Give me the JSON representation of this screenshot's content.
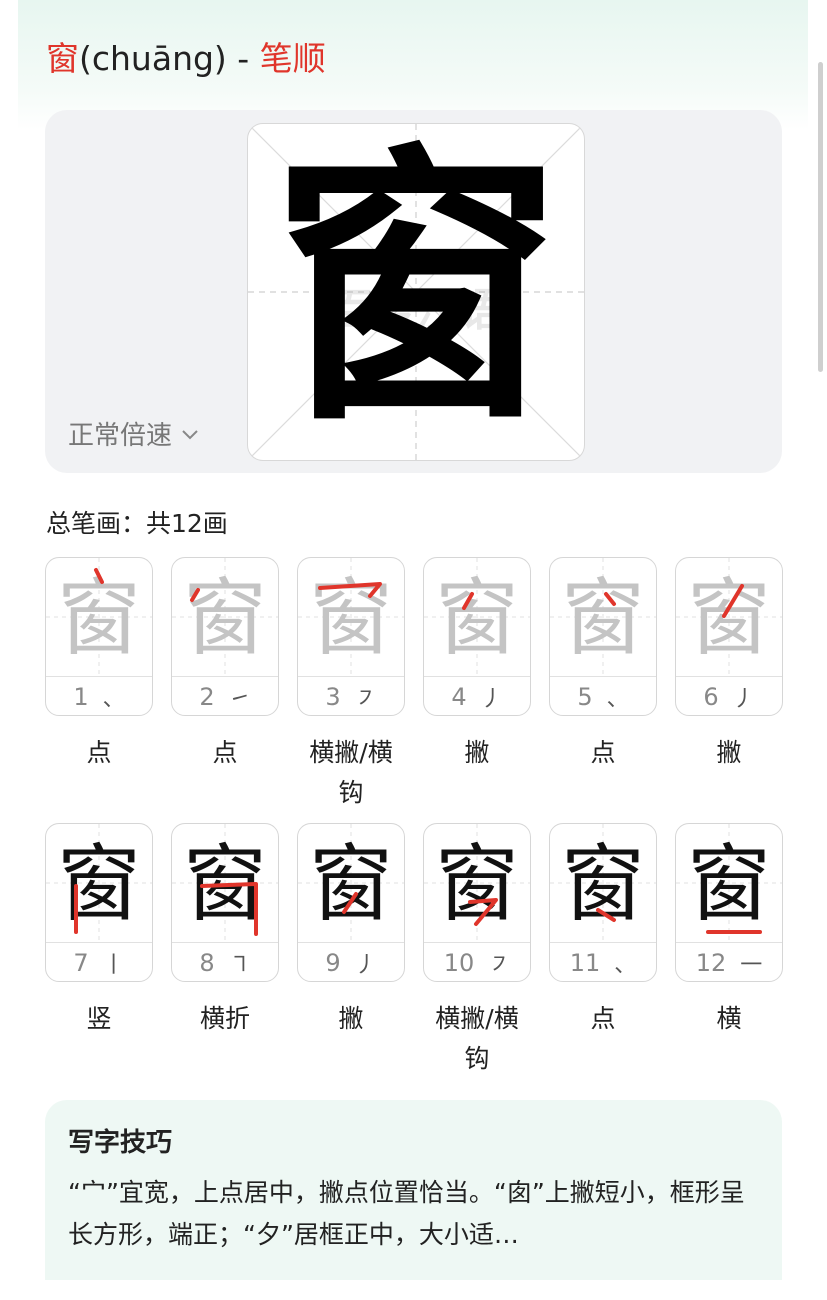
{
  "header": {
    "char": "窗",
    "pinyin": "(chuāng)",
    "separator": " - ",
    "section": "笔顺"
  },
  "animation": {
    "speed_label": "正常倍速",
    "speed_icon": "chevron-down-icon",
    "watermark": "百度汉语"
  },
  "total_label": "总笔画：共12画",
  "strokes": [
    {
      "num": "1",
      "glyph": "、",
      "name": "点"
    },
    {
      "num": "2",
      "glyph": "㇀",
      "name": "点"
    },
    {
      "num": "3",
      "glyph": "㇇",
      "name": "横撇/横钩"
    },
    {
      "num": "4",
      "glyph": "丿",
      "name": "撇"
    },
    {
      "num": "5",
      "glyph": "、",
      "name": "点"
    },
    {
      "num": "6",
      "glyph": "丿",
      "name": "撇"
    },
    {
      "num": "7",
      "glyph": "丨",
      "name": "竖"
    },
    {
      "num": "8",
      "glyph": "㇕",
      "name": "横折"
    },
    {
      "num": "9",
      "glyph": "丿",
      "name": "撇"
    },
    {
      "num": "10",
      "glyph": "㇇",
      "name": "横撇/横钩"
    },
    {
      "num": "11",
      "glyph": "、",
      "name": "点"
    },
    {
      "num": "12",
      "glyph": "一",
      "name": "横"
    }
  ],
  "tips": {
    "title": "写字技巧",
    "text": "“宀”宜宽，上点居中，撇点位置恰当。“囱”上撇短小，框形呈长方形，端正；“夕”居框正中，大小适…"
  },
  "colors": {
    "accent_red": "#e0352b",
    "header_green": "#e7f6f0",
    "tips_bg": "#eef8f4"
  }
}
